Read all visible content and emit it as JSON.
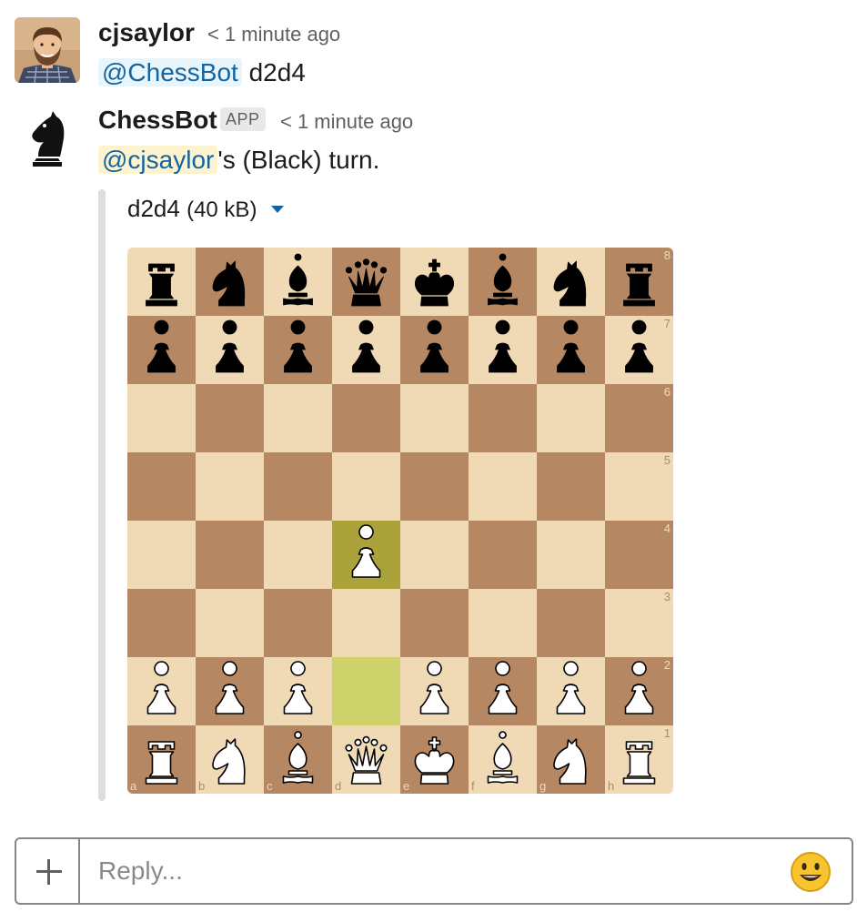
{
  "messages": [
    {
      "sender": "cjsaylor",
      "timestamp": "< 1 minute ago",
      "mention": "@ChessBot",
      "text": " d2d4"
    },
    {
      "sender": "ChessBot",
      "badge": "APP",
      "timestamp": "< 1 minute ago",
      "mention": "@cjsaylor",
      "text": "'s (Black) turn.",
      "attachment": {
        "title": "d2d4",
        "size": "(40 kB)"
      }
    }
  ],
  "board": {
    "colors": {
      "light": "#f0d9b5",
      "dark": "#b58863",
      "last_move_from": "#cdd26a",
      "last_move_to": "#aaa23a"
    },
    "last_move": {
      "from": "d2",
      "to": "d4"
    },
    "files": [
      "a",
      "b",
      "c",
      "d",
      "e",
      "f",
      "g",
      "h"
    ],
    "ranks": [
      "8",
      "7",
      "6",
      "5",
      "4",
      "3",
      "2",
      "1"
    ],
    "position": [
      [
        "r",
        "n",
        "b",
        "q",
        "k",
        "b",
        "n",
        "r"
      ],
      [
        "p",
        "p",
        "p",
        "p",
        "p",
        "p",
        "p",
        "p"
      ],
      [
        "",
        "",
        "",
        "",
        "",
        "",
        "",
        ""
      ],
      [
        "",
        "",
        "",
        "",
        "",
        "",
        "",
        ""
      ],
      [
        "",
        "",
        "",
        "P",
        "",
        "",
        "",
        ""
      ],
      [
        "",
        "",
        "",
        "",
        "",
        "",
        "",
        ""
      ],
      [
        "P",
        "P",
        "P",
        "",
        "P",
        "P",
        "P",
        "P"
      ],
      [
        "R",
        "N",
        "B",
        "Q",
        "K",
        "B",
        "N",
        "R"
      ]
    ]
  },
  "composer": {
    "placeholder": "Reply...",
    "add_icon": "plus-icon",
    "emoji_icon": "smiley-face-icon"
  },
  "icons": {
    "avatar_chessbot": "black-knight-icon"
  }
}
